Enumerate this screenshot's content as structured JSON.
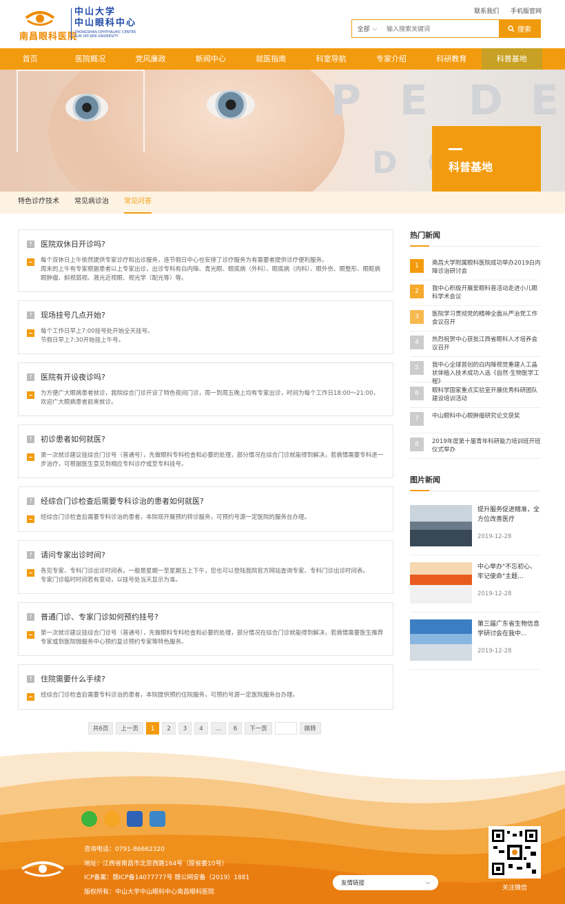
{
  "header": {
    "hospital_name": "南昌眼科医院",
    "university": "中山大学",
    "center": "中山眼科中心",
    "center_en": "ZHONGSHAN OPHTHALMIC CENTER SUN YAT-SEN UNIVERSITY",
    "top_links": [
      "联系我们",
      "手机版官网"
    ],
    "search_select": "全部",
    "search_placeholder": "输入搜索关键词",
    "search_button": "搜索"
  },
  "nav": [
    "首页",
    "医院概况",
    "党风廉政",
    "新闻中心",
    "就医指南",
    "科室导航",
    "专家介绍",
    "科研教育",
    "科普基地"
  ],
  "nav_active": 8,
  "banner": {
    "title": "科普基地"
  },
  "subtabs": [
    "特色诊疗技术",
    "常见病诊治",
    "常见问答"
  ],
  "subtab_active": 2,
  "faqs": [
    {
      "q": "医院双休日开诊吗?",
      "a": "每个双休日上午依然提供专家诊疗和出诊服务，连节假日中心也安排了诊疗服务为有需要者提供诊疗便利服务。\n周末的上午有专家根据患者以上专家出诊，出诊专科有白内障、青光眼、眼底病（外科）、眼底病（内科）、眼外伤、眼整形、眼眶病眼肿瘤、斜视弱视、激光近视眼、视光学（配光等）等。"
    },
    {
      "q": "现场挂号几点开始?",
      "a": "每个工作日早上7:00挂号处开始全天挂号。\n节假日早上7:30开始挂上午号。"
    },
    {
      "q": "医院有开设夜诊吗?",
      "a": "为方便广大眼病患者就诊，我院综合门诊开设了特色夜间门诊，周一到周五晚上均有专家出诊，时间为每个工作日18:00～21:00，欢迎广大眼病患者前来就诊。"
    },
    {
      "q": "初诊患者如何就医?",
      "a": "第一次就诊建议挂综合门诊号（普通号），先做眼科专科检查和必要的处理，部分情况在综合门诊就能得到解决，若病情需要专科进一步治疗，可根据医生意见到相应专科诊疗或至专科挂号。"
    },
    {
      "q": "经综合门诊检查后需要专科诊治的患者如何就医?",
      "a": "经综合门诊检查后需要专科诊治的患者，本院现开展预约转诊服务，可预约号源一定医院的服务台办理。"
    },
    {
      "q": "请问专家出诊时间?",
      "a": "各见专家、专科门诊出诊时间表，一般是星期一至星期五上下午，您也可以登陆我院官方网站查询专家、专科门诊出诊时间表。\n专家门诊临时时间若有变动，以挂号处当天显示为准。"
    },
    {
      "q": "普通门诊、专家门诊如何预约挂号?",
      "a": "第一次就诊建议挂综合门诊号（普通号），先做眼科专科检查和必要的处理，部分情况在综合门诊就能得到解决，若病情需要医生推荐专家或到医院微服务中心预约复诊预约专家等特色服务。"
    },
    {
      "q": "住院需要什么手续?",
      "a": "经综合门诊检查后需要专科诊治的患者，本院提供预约住院服务，可预约号源一定医院服务台办理。"
    }
  ],
  "pager": {
    "total": "共6页",
    "prev": "上一页",
    "pages": [
      "1",
      "2",
      "3",
      "4",
      "...",
      "6"
    ],
    "current": "1",
    "next": "下一页",
    "go": "跳转"
  },
  "sidebar": {
    "hot_title": "热门新闻",
    "hot": [
      {
        "n": "1",
        "t": "南昌大学附属眼科医院成功举办2019白内障诊治研讨会"
      },
      {
        "n": "2",
        "t": "我中心积极开展爱眼科普活动走进小儿眼科学术会议"
      },
      {
        "n": "3",
        "t": "医院学习贯彻党的精神全面从严治党工作会议召开"
      },
      {
        "n": "4",
        "t": "热烈祝贺中心获批江西省眼科人才培养会议召开"
      },
      {
        "n": "5",
        "t": "我中心全球首创的白内障视觉重建人工晶状体植入技术成功入选《自然·生物医学工程》"
      },
      {
        "n": "6",
        "t": "眼科学国家重点实验室开展优秀科研团队建设培训活动"
      },
      {
        "n": "7",
        "t": "中山眼科中心眼肿瘤研究论文获奖"
      },
      {
        "n": "8",
        "t": "2019年度第十届青年科研能力培训班开班仪式举办"
      }
    ],
    "pic_title": "图片新闻",
    "pics": [
      {
        "t": "提升服务促进精准，全方位改善医疗",
        "d": "2019-12-28"
      },
      {
        "t": "中心举办\"不忘初心、牢记使命\"主题...",
        "d": "2019-12-28"
      },
      {
        "t": "第三届广东省生物信息学研讨会在我中...",
        "d": "2019-12-28"
      }
    ]
  },
  "footer": {
    "lines": [
      "咨询电话：0791-86662320",
      "地址：江西省南昌市北京西路164号（原省委10号）",
      "ICP备案：赣ICP备14077777号   赣公网安备（2019）1881",
      "版权所有：中山大学中山眼科中心南昌眼科医院"
    ],
    "lang": "友情链接",
    "qr_caption": "关注微信"
  },
  "colors": {
    "accent": "#f39b0e",
    "nav_active": "#c8a023",
    "brand_blue": "#1f4aa8"
  }
}
